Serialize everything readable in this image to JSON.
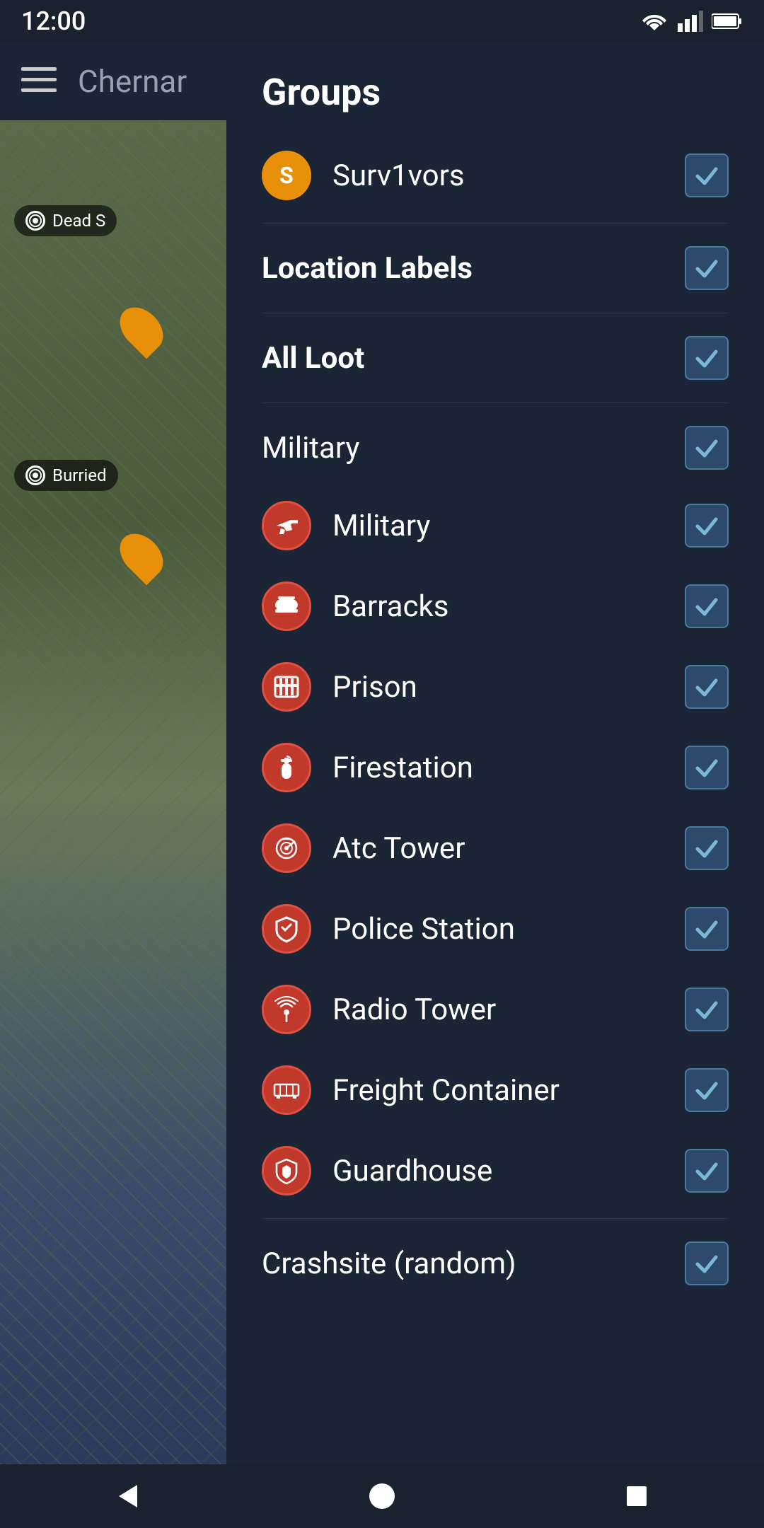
{
  "statusBar": {
    "time": "12:00"
  },
  "appHeader": {
    "title": "Chernar"
  },
  "mapLabels": [
    {
      "id": "label-1",
      "text": "Dead S"
    },
    {
      "id": "label-2",
      "text": "Burried"
    }
  ],
  "drawer": {
    "title": "Groups",
    "items": [
      {
        "id": "surv1vors",
        "label": "Surv1vors",
        "hasIcon": true,
        "iconType": "letter",
        "iconLetter": "S",
        "iconColor": "#e8900a",
        "checked": true,
        "isBold": false,
        "isSection": false
      },
      {
        "id": "location-labels",
        "label": "Location Labels",
        "hasIcon": false,
        "iconType": null,
        "checked": true,
        "isBold": true,
        "isSection": false
      },
      {
        "id": "all-loot",
        "label": "All Loot",
        "hasIcon": false,
        "iconType": null,
        "checked": true,
        "isBold": true,
        "isSection": false
      },
      {
        "id": "military-section",
        "label": "Military",
        "hasIcon": false,
        "iconType": null,
        "checked": true,
        "isBold": false,
        "isSection": true
      },
      {
        "id": "military",
        "label": "Military",
        "hasIcon": true,
        "iconType": "red",
        "iconShape": "gun",
        "checked": true,
        "isBold": false,
        "isSection": false
      },
      {
        "id": "barracks",
        "label": "Barracks",
        "hasIcon": true,
        "iconType": "red",
        "iconShape": "barracks",
        "checked": true,
        "isBold": false,
        "isSection": false
      },
      {
        "id": "prison",
        "label": "Prison",
        "hasIcon": true,
        "iconType": "red",
        "iconShape": "prison",
        "checked": true,
        "isBold": false,
        "isSection": false
      },
      {
        "id": "firestation",
        "label": "Firestation",
        "hasIcon": true,
        "iconType": "red",
        "iconShape": "fire",
        "checked": true,
        "isBold": false,
        "isSection": false
      },
      {
        "id": "atc-tower",
        "label": "Atc Tower",
        "hasIcon": true,
        "iconType": "red",
        "iconShape": "atc",
        "checked": true,
        "isBold": false,
        "isSection": false
      },
      {
        "id": "police-station",
        "label": "Police Station",
        "hasIcon": true,
        "iconType": "red",
        "iconShape": "police",
        "checked": true,
        "isBold": false,
        "isSection": false
      },
      {
        "id": "radio-tower",
        "label": "Radio Tower",
        "hasIcon": true,
        "iconType": "red",
        "iconShape": "radio",
        "checked": true,
        "isBold": false,
        "isSection": false
      },
      {
        "id": "freight-container",
        "label": "Freight Container",
        "hasIcon": true,
        "iconType": "red",
        "iconShape": "freight",
        "checked": true,
        "isBold": false,
        "isSection": false
      },
      {
        "id": "guardhouse",
        "label": "Guardhouse",
        "hasIcon": true,
        "iconType": "red",
        "iconShape": "guard",
        "checked": true,
        "isBold": false,
        "isSection": false
      },
      {
        "id": "crashsite",
        "label": "Crashsite (random)",
        "hasIcon": false,
        "iconType": null,
        "checked": true,
        "isBold": false,
        "isSection": true
      }
    ]
  },
  "icons": {
    "checkmark": "✓",
    "back": "◀",
    "home": "●",
    "recent": "■"
  }
}
